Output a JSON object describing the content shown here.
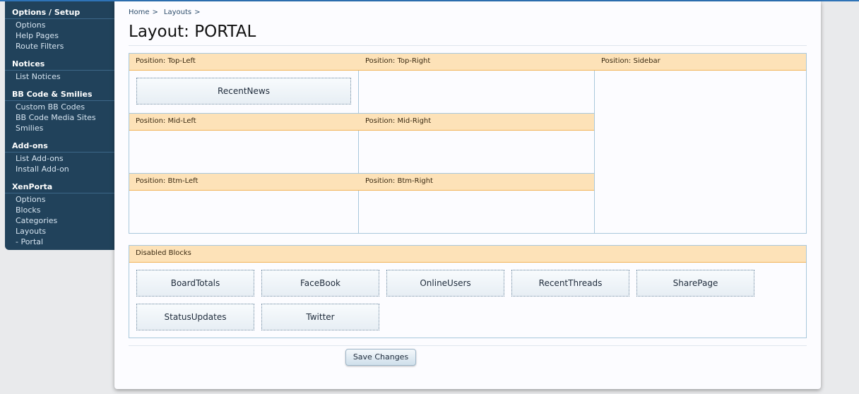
{
  "sidebar": {
    "groups": [
      {
        "title": "Options / Setup",
        "items": [
          "Options",
          "Help Pages",
          "Route Filters"
        ]
      },
      {
        "title": "Notices",
        "items": [
          "List Notices"
        ]
      },
      {
        "title": "BB Code & Smilies",
        "items": [
          "Custom BB Codes",
          "BB Code Media Sites",
          "Smilies"
        ]
      },
      {
        "title": "Add-ons",
        "items": [
          "List Add-ons",
          "Install Add-on"
        ]
      },
      {
        "title": "XenPorta",
        "items": [
          "Options",
          "Blocks",
          "Categories",
          "Layouts",
          "- Portal"
        ]
      }
    ]
  },
  "breadcrumb": {
    "home": "Home",
    "layouts": "Layouts",
    "separator": ">"
  },
  "title": "Layout: PORTAL",
  "positions": {
    "top_left": "Position: Top-Left",
    "top_right": "Position: Top-Right",
    "sidebar": "Position: Sidebar",
    "mid_left": "Position: Mid-Left",
    "mid_right": "Position: Mid-Right",
    "btm_left": "Position: Btm-Left",
    "btm_right": "Position: Btm-Right"
  },
  "active_blocks": {
    "top_left": [
      "RecentNews"
    ]
  },
  "disabled": {
    "title": "Disabled Blocks",
    "blocks": [
      "BoardTotals",
      "FaceBook",
      "OnlineUsers",
      "RecentThreads",
      "SharePage",
      "StatusUpdates",
      "Twitter"
    ]
  },
  "save_label": "Save Changes",
  "colors": {
    "sidebar_bg": "#21425b",
    "header_bg": "#fde2b8",
    "header_border": "#f2b45a",
    "border": "#a9c8dc"
  }
}
